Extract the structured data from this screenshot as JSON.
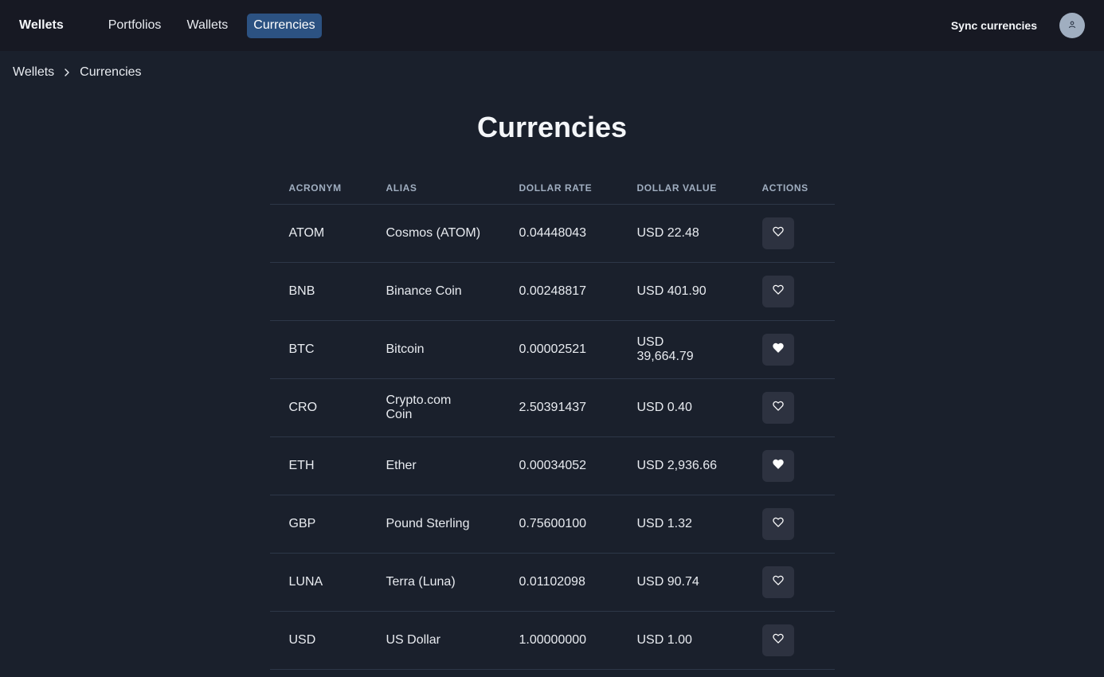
{
  "nav": {
    "brand": "Wellets",
    "links": [
      {
        "label": "Portfolios",
        "active": false
      },
      {
        "label": "Wallets",
        "active": false
      },
      {
        "label": "Currencies",
        "active": true
      }
    ],
    "sync_label": "Sync currencies",
    "avatar_icon": "user-icon"
  },
  "breadcrumb": {
    "root": "Wellets",
    "current": "Currencies"
  },
  "page": {
    "title": "Currencies"
  },
  "table": {
    "headers": [
      "ACRONYM",
      "ALIAS",
      "DOLLAR RATE",
      "DOLLAR VALUE",
      "ACTIONS"
    ],
    "rows": [
      {
        "acronym": "ATOM",
        "alias": "Cosmos (ATOM)",
        "rate": "0.04448043",
        "value": "USD 22.48",
        "favorite": false
      },
      {
        "acronym": "BNB",
        "alias": "Binance Coin",
        "rate": "0.00248817",
        "value": "USD 401.90",
        "favorite": false
      },
      {
        "acronym": "BTC",
        "alias": "Bitcoin",
        "rate": "0.00002521",
        "value": "USD 39,664.79",
        "favorite": true
      },
      {
        "acronym": "CRO",
        "alias": "Crypto.com Coin",
        "rate": "2.50391437",
        "value": "USD 0.40",
        "favorite": false
      },
      {
        "acronym": "ETH",
        "alias": "Ether",
        "rate": "0.00034052",
        "value": "USD 2,936.66",
        "favorite": true
      },
      {
        "acronym": "GBP",
        "alias": "Pound Sterling",
        "rate": "0.75600100",
        "value": "USD 1.32",
        "favorite": false
      },
      {
        "acronym": "LUNA",
        "alias": "Terra (Luna)",
        "rate": "0.01102098",
        "value": "USD 90.74",
        "favorite": false
      },
      {
        "acronym": "USD",
        "alias": "US Dollar",
        "rate": "1.00000000",
        "value": "USD 1.00",
        "favorite": false
      }
    ]
  },
  "colors": {
    "background": "#1a202c",
    "navbar": "#171923",
    "active_nav": "#2c5282",
    "action_button": "#2d3240"
  }
}
